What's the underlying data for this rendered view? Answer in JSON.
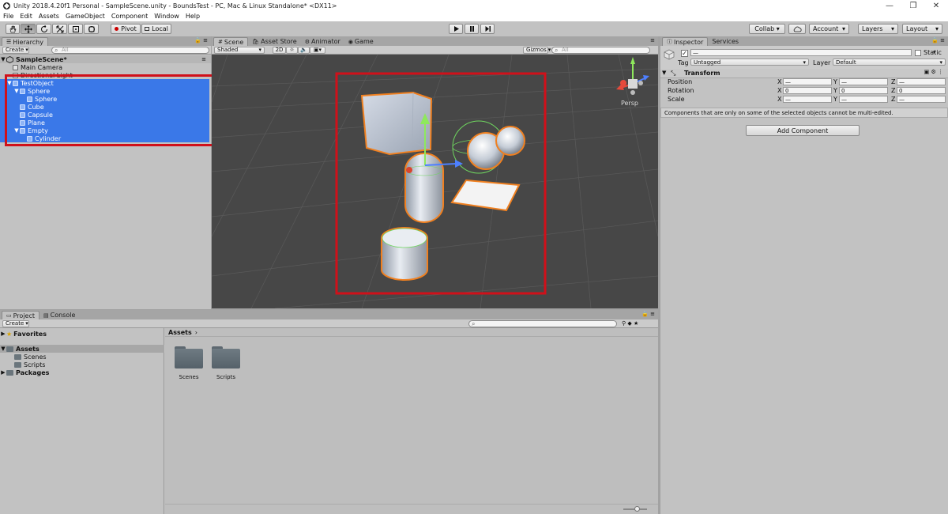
{
  "window": {
    "title": "Unity 2018.4.20f1 Personal - SampleScene.unity - BoundsTest - PC, Mac & Linux Standalone* <DX11>",
    "min_glyph": "—",
    "restore_glyph": "❐",
    "close_glyph": "✕"
  },
  "menu": [
    "File",
    "Edit",
    "Assets",
    "GameObject",
    "Component",
    "Window",
    "Help"
  ],
  "toolbar": {
    "pivot": "Pivot",
    "local": "Local",
    "collab": "Collab ▾",
    "account": "Account",
    "layers": "Layers",
    "layout": "Layout"
  },
  "hierarchy": {
    "tab": "Hierarchy",
    "create": "Create",
    "search_placeholder": "All",
    "scene": "SampleScene*",
    "items": [
      {
        "label": "Main Camera",
        "indent": 1,
        "selected": false,
        "arrow": ""
      },
      {
        "label": "Directional Light",
        "indent": 1,
        "selected": false,
        "arrow": ""
      },
      {
        "label": "TestObject",
        "indent": 1,
        "selected": true,
        "arrow": "▼"
      },
      {
        "label": "Sphere",
        "indent": 2,
        "selected": true,
        "arrow": "▼"
      },
      {
        "label": "Sphere",
        "indent": 3,
        "selected": true,
        "arrow": ""
      },
      {
        "label": "Cube",
        "indent": 2,
        "selected": true,
        "arrow": ""
      },
      {
        "label": "Capsule",
        "indent": 2,
        "selected": true,
        "arrow": ""
      },
      {
        "label": "Plane",
        "indent": 2,
        "selected": true,
        "arrow": ""
      },
      {
        "label": "Empty",
        "indent": 2,
        "selected": true,
        "arrow": "▼"
      },
      {
        "label": "Cylinder",
        "indent": 3,
        "selected": true,
        "arrow": ""
      }
    ]
  },
  "scene": {
    "tabs": [
      "Scene",
      "Asset Store",
      "Animator",
      "Game"
    ],
    "shading": "Shaded",
    "mode2d": "2D",
    "gizmos": "Gizmos",
    "search_placeholder": "All",
    "persp": "Persp"
  },
  "inspector": {
    "tabs": [
      "Inspector",
      "Services"
    ],
    "name_value": "—",
    "static_label": "Static",
    "tag_label": "Tag",
    "tag_value": "Untagged",
    "layer_label": "Layer",
    "layer_value": "Default",
    "transform_title": "Transform",
    "rows": [
      {
        "label": "Position",
        "x": "—",
        "y": "—",
        "z": "—"
      },
      {
        "label": "Rotation",
        "x": "0",
        "y": "0",
        "z": "0"
      },
      {
        "label": "Scale",
        "x": "—",
        "y": "—",
        "z": "—"
      }
    ],
    "axis_x": "X",
    "axis_y": "Y",
    "axis_z": "Z",
    "note": "Components that are only on some of the selected objects cannot be multi-edited.",
    "add_component": "Add Component"
  },
  "project": {
    "tabs": [
      "Project",
      "Console"
    ],
    "create": "Create",
    "favorites": "Favorites",
    "assets": "Assets",
    "scenes": "Scenes",
    "scripts": "Scripts",
    "packages": "Packages",
    "breadcrumb": "Assets",
    "folders": [
      "Scenes",
      "Scripts"
    ]
  },
  "colors": {
    "selection": "#3a78e8",
    "highlight_box": "#d0101a",
    "outline": "#f08020"
  }
}
